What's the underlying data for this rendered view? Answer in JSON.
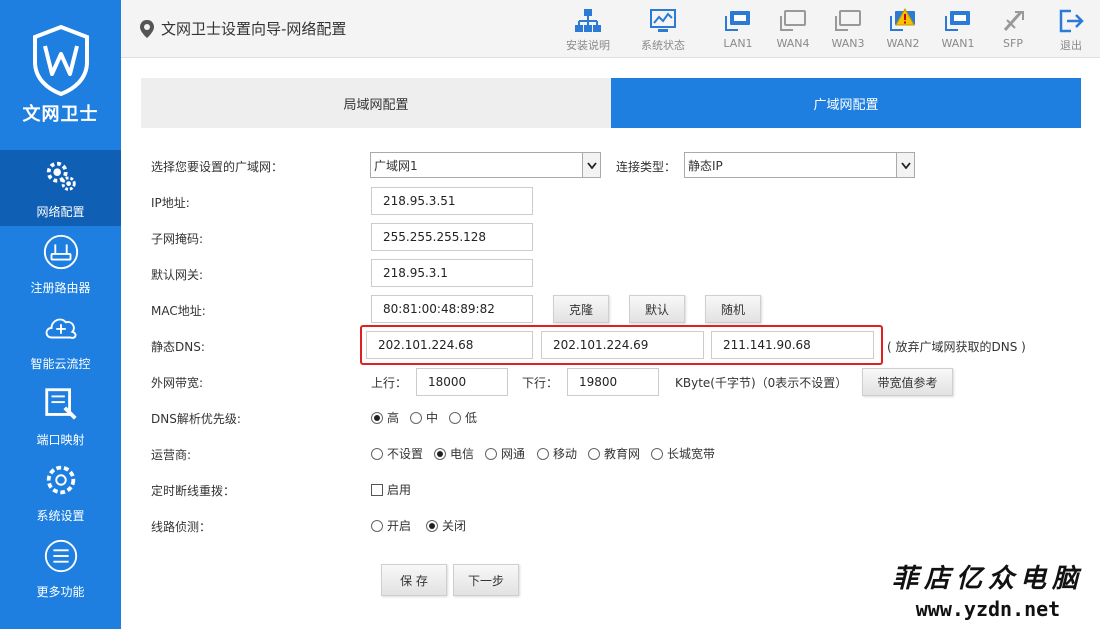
{
  "brand": {
    "name": "文网卫士"
  },
  "sidebar": {
    "items": [
      {
        "label": "网络配置",
        "icon": "gears-icon",
        "active": true
      },
      {
        "label": "注册路由器",
        "icon": "router-icon",
        "active": false
      },
      {
        "label": "智能云流控",
        "icon": "cloud-icon",
        "active": false
      },
      {
        "label": "端口映射",
        "icon": "port-map-icon",
        "active": false
      },
      {
        "label": "系统设置",
        "icon": "gear-icon",
        "active": false
      },
      {
        "label": "更多功能",
        "icon": "menu-icon",
        "active": false
      }
    ]
  },
  "header": {
    "breadcrumb": "文网卫士设置向导-网络配置",
    "toolbar": [
      {
        "label": "安装说明",
        "icon": "network-tree-icon"
      },
      {
        "label": "系统状态",
        "icon": "monitor-chart-icon"
      },
      {
        "label": "LAN1",
        "icon": "port-connected-icon"
      },
      {
        "label": "WAN4",
        "icon": "port-disconnected-icon"
      },
      {
        "label": "WAN3",
        "icon": "port-disconnected-icon"
      },
      {
        "label": "WAN2",
        "icon": "port-warning-icon"
      },
      {
        "label": "WAN1",
        "icon": "port-connected-icon"
      },
      {
        "label": "SFP",
        "icon": "sfp-disconnected-icon"
      },
      {
        "label": "退出",
        "icon": "logout-icon"
      }
    ]
  },
  "tabs": [
    {
      "label": "局域网配置",
      "active": false
    },
    {
      "label": "广域网配置",
      "active": true
    }
  ],
  "form": {
    "wan_select": {
      "label": "选择您要设置的广域网：",
      "value": "广域网1"
    },
    "conn_type": {
      "label": "连接类型：",
      "value": "静态IP"
    },
    "ip": {
      "label": "IP地址:",
      "value": "218.95.3.51"
    },
    "mask": {
      "label": "子网掩码:",
      "value": "255.255.255.128"
    },
    "gateway": {
      "label": "默认网关:",
      "value": "218.95.3.1"
    },
    "mac": {
      "label": "MAC地址:",
      "value": "80:81:00:48:89:82",
      "buttons": [
        "克隆",
        "默认",
        "随机"
      ]
    },
    "dns": {
      "label": "静态DNS:",
      "values": [
        "202.101.224.68",
        "202.101.224.69",
        "211.141.90.68"
      ],
      "note": "( 放弃广域网获取的DNS )"
    },
    "bandwidth": {
      "label": "外网带宽:",
      "up_label": "上行：",
      "up": "18000",
      "down_label": "下行：",
      "down": "19800",
      "unit": "KByte(千字节)（0表示不设置）",
      "ref_button": "带宽值参考"
    },
    "dns_priority": {
      "label": "DNS解析优先级:",
      "options": [
        "高",
        "中",
        "低"
      ],
      "selected": "高"
    },
    "isp": {
      "label": "运营商:",
      "options": [
        "不设置",
        "电信",
        "网通",
        "移动",
        "教育网",
        "长城宽带"
      ],
      "selected": "电信"
    },
    "redial": {
      "label": "定时断线重拨：",
      "option": "启用",
      "checked": false
    },
    "detect": {
      "label": "线路侦测：",
      "options": [
        "开启",
        "关闭"
      ],
      "selected": "关闭"
    },
    "save": "保 存",
    "next": "下一步"
  },
  "watermark": {
    "cn": "菲店亿众电脑",
    "url": "www.yzdn.net"
  }
}
